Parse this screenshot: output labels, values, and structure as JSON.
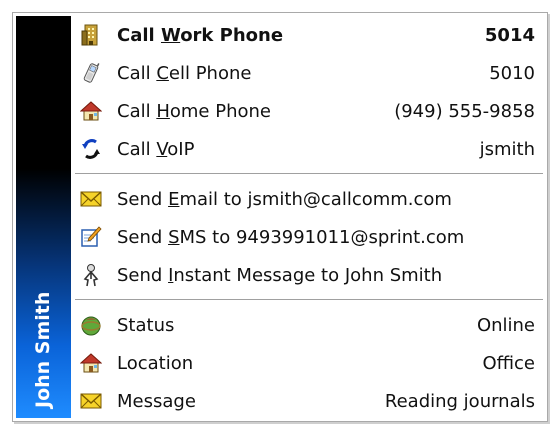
{
  "sidebar": {
    "contact_name": "John Smith"
  },
  "menu": {
    "call_work": {
      "pre": "Call ",
      "key": "W",
      "post": "ork Phone",
      "value": "5014"
    },
    "call_cell": {
      "pre": "Call ",
      "key": "C",
      "post": "ell Phone",
      "value": "5010"
    },
    "call_home": {
      "pre": "Call ",
      "key": "H",
      "post": "ome Phone",
      "value": "(949) 555-9858"
    },
    "call_voip": {
      "pre": "Call ",
      "key": "V",
      "post": "oIP",
      "value": "jsmith"
    },
    "send_email": {
      "pre": "Send ",
      "key": "E",
      "post": "mail to jsmith@callcomm.com"
    },
    "send_sms": {
      "pre": "Send ",
      "key": "S",
      "post": "MS to 9493991011@sprint.com"
    },
    "send_im": {
      "pre": "Send ",
      "key": "I",
      "post": "nstant Message to John Smith"
    },
    "status": {
      "label": "Status",
      "value": "Online"
    },
    "location": {
      "label": "Location",
      "value": "Office"
    },
    "message": {
      "label": "Message",
      "value": "Reading journals"
    }
  },
  "icons": {
    "work_phone": "office-building-icon",
    "cell_phone": "cell-phone-icon",
    "home_phone": "house-icon",
    "voip": "voip-arrows-icon",
    "email": "envelope-icon",
    "sms": "notepad-pen-icon",
    "im": "person-icon",
    "status": "presence-globe-icon",
    "location": "house-icon",
    "message": "envelope-icon"
  }
}
